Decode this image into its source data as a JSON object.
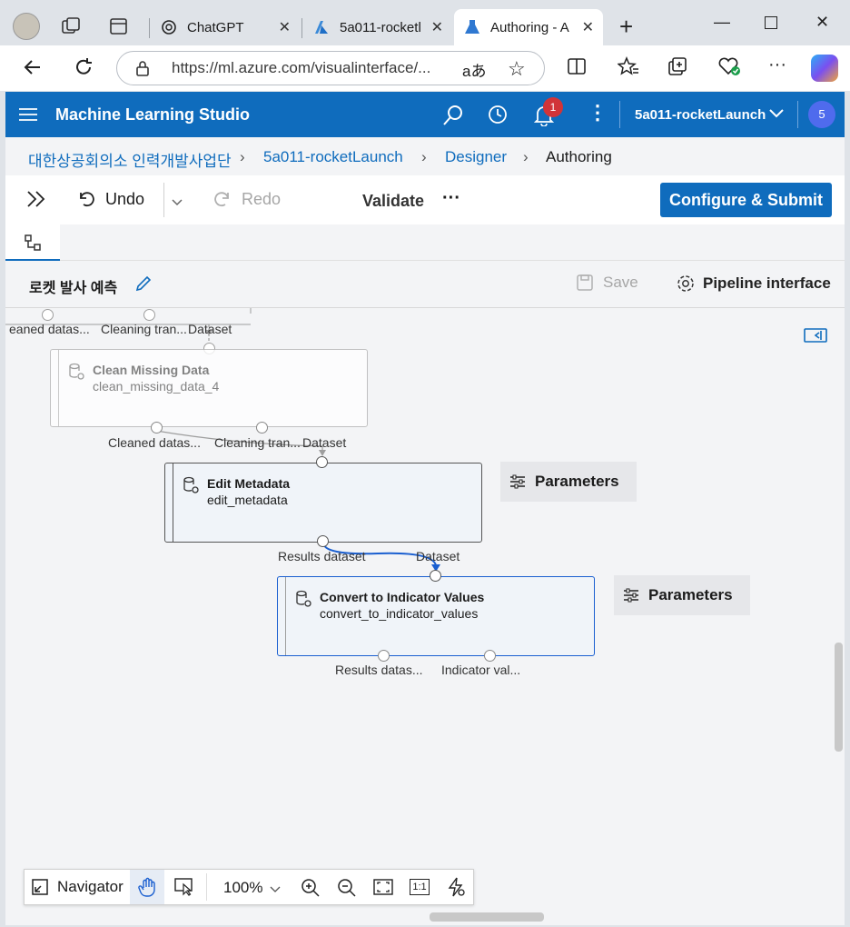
{
  "browser": {
    "tabs": [
      {
        "label": "ChatGPT",
        "icon": "chatgpt-icon"
      },
      {
        "label": "5a011-rocketl",
        "icon": "azure-icon"
      },
      {
        "label": "Authoring - A",
        "icon": "flask-icon",
        "active": true
      }
    ],
    "url": "https://ml.azure.com/visualinterface/...",
    "read_aloud": "aあ"
  },
  "app": {
    "name": "Machine Learning Studio",
    "notification_count": "1",
    "workspace": "5a011-rocketLaunch",
    "avatar": "5",
    "accent": "#0f6cbd"
  },
  "breadcrumb": [
    "대한상공회의소 인력개발사업단",
    "5a011-rocketLaunch",
    "Designer",
    "Authoring"
  ],
  "toolbar": {
    "undo": "Undo",
    "redo": "Redo",
    "validate": "Validate",
    "more": "···",
    "submit": "Configure & Submit"
  },
  "pipeline": {
    "title": "로켓 발사 예측",
    "save": "Save",
    "interface": "Pipeline interface"
  },
  "canvas": {
    "top_labels": [
      "eaned datas...",
      "Cleaning tran...",
      "Dataset"
    ],
    "nodes": [
      {
        "title": "Clean Missing Data",
        "subtitle": "clean_missing_data_4",
        "outputs": [
          "Cleaned datas...",
          "Cleaning tran..."
        ]
      },
      {
        "input": "Dataset",
        "title": "Edit Metadata",
        "subtitle": "edit_metadata",
        "outputs": [
          "Results dataset"
        ],
        "params": "Parameters"
      },
      {
        "input": "Dataset",
        "title": "Convert to Indicator Values",
        "subtitle": "convert_to_indicator_values",
        "outputs": [
          "Results datas...",
          "Indicator val..."
        ],
        "params": "Parameters"
      }
    ]
  },
  "navigator": {
    "label": "Navigator",
    "zoom": "100%",
    "one_to_one": "1:1"
  }
}
